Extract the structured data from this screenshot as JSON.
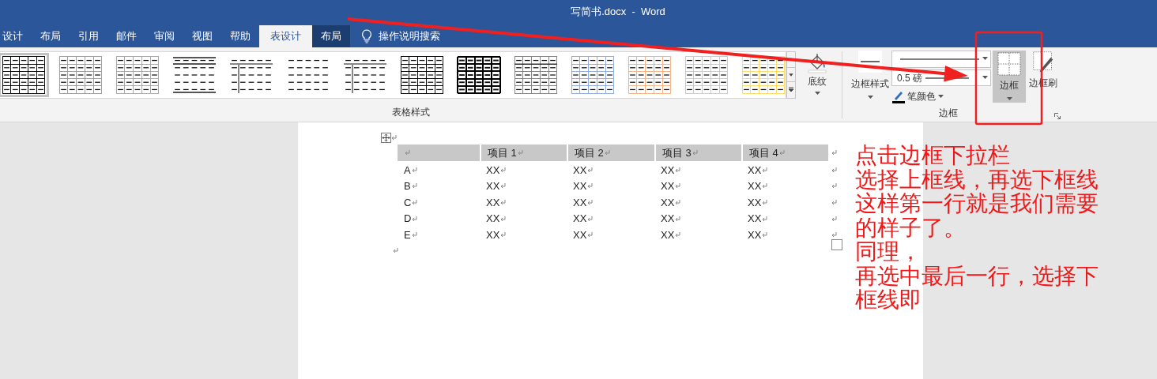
{
  "window": {
    "title": "写简书.docx  -  Word"
  },
  "tabs": [
    {
      "label": "设计",
      "selected": false,
      "contextual": false
    },
    {
      "label": "布局",
      "selected": false,
      "contextual": false
    },
    {
      "label": "引用",
      "selected": false,
      "contextual": false
    },
    {
      "label": "邮件",
      "selected": false,
      "contextual": false
    },
    {
      "label": "审阅",
      "selected": false,
      "contextual": false
    },
    {
      "label": "视图",
      "selected": false,
      "contextual": false
    },
    {
      "label": "帮助",
      "selected": false,
      "contextual": false
    },
    {
      "label": "表设计",
      "selected": true,
      "contextual": true
    },
    {
      "label": "布局",
      "selected": false,
      "contextual": true
    }
  ],
  "tell_me": {
    "label": "操作说明搜索"
  },
  "table_styles": {
    "label": "表格样式",
    "gallery": [
      {
        "kind": "grid",
        "color": "#000000",
        "selected": true
      },
      {
        "kind": "light-grid",
        "color": "#9a9a9a",
        "selected": false
      },
      {
        "kind": "grid",
        "color": "#a6a6a6",
        "selected": false
      },
      {
        "kind": "horizontal",
        "color": "#555555",
        "selected": false
      },
      {
        "kind": "tee",
        "color": "#888888",
        "selected": false
      },
      {
        "kind": "plain",
        "selected": false
      },
      {
        "kind": "tee",
        "color": "#888888",
        "selected": false
      },
      {
        "kind": "grid",
        "color": "#000000",
        "selected": false
      },
      {
        "kind": "bold",
        "color": "#000000",
        "selected": false
      },
      {
        "kind": "header-grid",
        "color": "#7f7f7f",
        "selected": false
      },
      {
        "kind": "grid",
        "color": "#8eaadb",
        "selected": false
      },
      {
        "kind": "grid",
        "color": "#f4b183",
        "selected": false
      },
      {
        "kind": "grid",
        "color": "#c9c9c9",
        "selected": false
      },
      {
        "kind": "grid",
        "color": "#ffd966",
        "selected": false
      }
    ],
    "shading_button": {
      "label": "底纹"
    }
  },
  "borders": {
    "label": "边框",
    "border_styles_button": {
      "label": "边框样式"
    },
    "line_weight": {
      "value": "0.5 磅"
    },
    "pen_color": {
      "label": "笔颜色"
    },
    "borders_button": {
      "label": "边框",
      "pressed": true
    },
    "border_painter": {
      "label": "边框刷"
    }
  },
  "document": {
    "table": {
      "columns": [
        "",
        "项目 1",
        "项目 2",
        "项目 3",
        "项目 4"
      ],
      "rows": [
        [
          "A",
          "XX",
          "XX",
          "XX",
          "XX"
        ],
        [
          "B",
          "XX",
          "XX",
          "XX",
          "XX"
        ],
        [
          "C",
          "XX",
          "XX",
          "XX",
          "XX"
        ],
        [
          "D",
          "XX",
          "XX",
          "XX",
          "XX"
        ],
        [
          "E",
          "XX",
          "XX",
          "XX",
          "XX"
        ]
      ]
    }
  },
  "annotation": {
    "lines": [
      "点击边框下拉栏",
      "选择上框线，再选下框线",
      "这样第一行就是我们需要",
      "的样子了。",
      "同理，",
      "再选中最后一行，选择下",
      "框线即"
    ]
  }
}
